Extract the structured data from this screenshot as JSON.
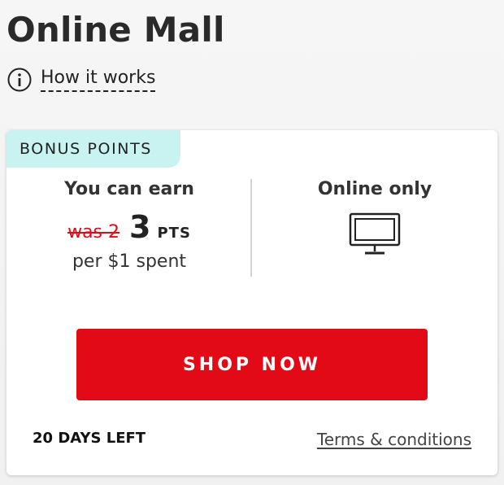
{
  "page": {
    "title": "Online Mall",
    "how_it_works_label": "How it works"
  },
  "offer": {
    "badge": "BONUS POINTS",
    "earn_heading": "You can earn",
    "was_label": "was 2",
    "points_value": "3",
    "points_unit": "PTS",
    "per_spent": "per $1 spent",
    "channel_label": "Online only",
    "channel_icon": "monitor-icon",
    "cta_label": "SHOP NOW",
    "days_left": "20 DAYS LEFT",
    "terms_label": "Terms & conditions"
  },
  "colors": {
    "accent_red": "#e30a17",
    "badge_bg": "#c9f3f1"
  }
}
